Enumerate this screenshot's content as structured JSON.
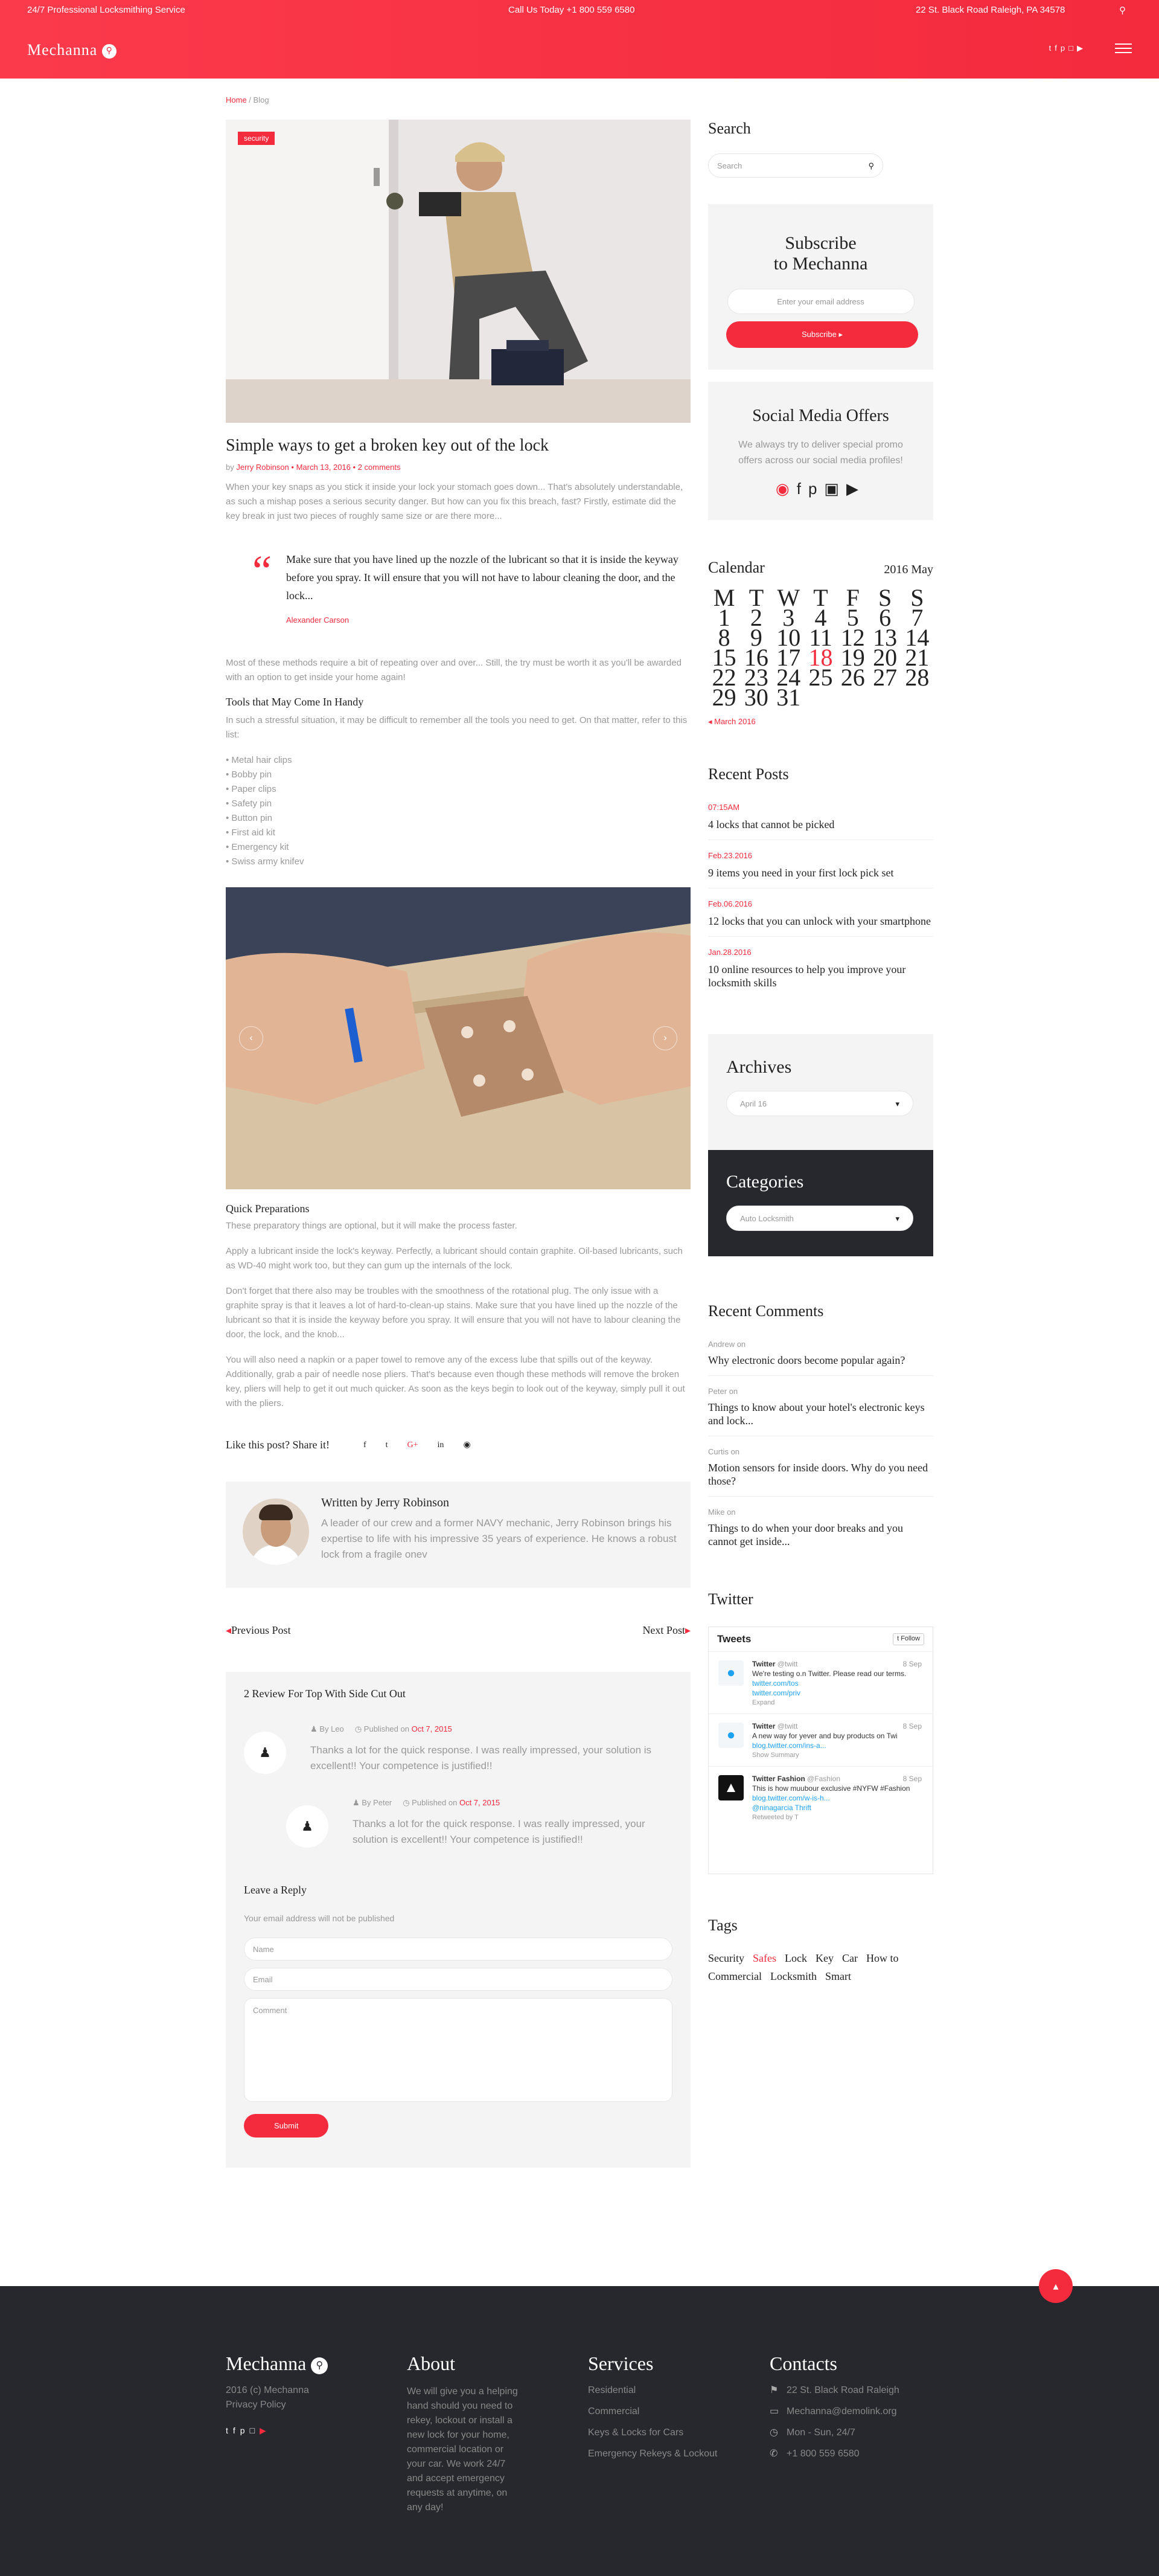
{
  "header": {
    "tagline": "24/7 Professional Locksmithing Service",
    "call": "Call Us Today +1 800 559 6580",
    "address": "22 St. Black Road Raleigh, PA 34578",
    "logo": "Mechanna",
    "social_icons": [
      "twitter-icon",
      "facebook-icon",
      "pinterest-icon",
      "instagram-icon",
      "youtube-icon"
    ]
  },
  "breadcrumb": {
    "home": "Home",
    "sep": " / ",
    "current": "Blog"
  },
  "post": {
    "category": "security",
    "title": "Simple ways to get a broken key out of the lock",
    "by": "by ",
    "author": "Jerry Robinson",
    "date": "March 13, 2016",
    "comments": "2 comments",
    "intro": "When your key snaps as you stick it inside your lock your stomach goes down... That's absolutely understandable, as such a mishap poses a serious security danger. But how can you fix this breach, fast? Firstly, estimate did the key break in just two pieces of roughly same size or are there more...",
    "quote_text": "Make sure that you have lined up the nozzle of the lubricant so that it is inside the keyway before you spray. It will ensure that you will not have to labour cleaning the door, and the lock...",
    "quote_author": "Alexander Carson",
    "para2": "Most of these methods require a bit of repeating over and over... Still, the try must be worth it as you'll be awarded with an option to get inside your home again!",
    "tools_heading": "Tools that May Come In Handy",
    "tools_intro": "In such a stressful situation, it may be difficult to remember all the tools you need to get. On that matter, refer to this list:",
    "tools": [
      "• Metal hair clips",
      "• Bobby pin",
      "• Paper clips",
      "• Safety pin",
      "• Button pin",
      "• First aid kit",
      "• Emergency kit",
      "• Swiss army knifev"
    ],
    "prep_heading": "Quick Preparations",
    "prep1": "These preparatory things are optional, but it will make the process faster.",
    "prep2": "Apply a lubricant inside the lock's keyway. Perfectly, a lubricant should contain graphite. Oil-based lubricants, such as WD-40 might work too, but they can gum up the internals of the lock.",
    "prep3": "Don't forget that there also may be troubles with the smoothness of the rotational plug. The only issue with a graphite spray is that it leaves a lot of hard-to-clean-up stains. Make sure that you have lined up the nozzle of the lubricant so that it is inside the keyway before you spray. It will ensure that you will not have to labour cleaning the door, the lock, and the knob...",
    "prep4": "You will also need a napkin or a paper towel to remove any of the excess lube that spills out of the keyway. Additionally, grab a pair of needle nose pliers. That's because even though these methods will remove the broken key, pliers will help to get it out much quicker. As soon as the keys begin to look out of the keyway, simply pull it out with the pliers.",
    "share_label": "Like this post? Share it!",
    "share_icons": [
      "facebook-icon",
      "twitter-icon",
      "google-plus-icon",
      "linkedin-icon",
      "pinterest-icon"
    ]
  },
  "author_box": {
    "written": "Written by Jerry Robinson",
    "bio": "A leader of our crew and a former NAVY mechanic, Jerry Robinson brings his expertise to life with his impressive 35 years of experience. He knows a robust lock from a fragile onev"
  },
  "post_nav": {
    "prev": "Previous Post",
    "next": "Next Post"
  },
  "comments": {
    "title": "2 Review For Top With Side Cut Out",
    "items": [
      {
        "by": "By Leo",
        "published": "Published on ",
        "date": "Oct 7, 2015",
        "text": "Thanks a lot for the quick response. I was really impressed, your solution is excellent!! Your competence is justified!!"
      },
      {
        "by": "By Peter",
        "published": "Published on ",
        "date": "Oct 7, 2015",
        "text": "Thanks a lot for the quick response. I was really impressed, your solution is excellent!! Your competence is justified!!"
      }
    ],
    "reply_title": "Leave a Reply",
    "note": "Your email address will not be published",
    "name_ph": "Name",
    "email_ph": "Email",
    "comment_ph": "Comment",
    "submit": "Submit"
  },
  "sidebar": {
    "search_title": "Search",
    "search_ph": "Search",
    "subscribe_title1": "Subscribe",
    "subscribe_title2": "to Mechanna",
    "email_ph": "Enter your email address",
    "subscribe_btn": "Subscribe",
    "social_title": "Social Media Offers",
    "social_text": "We always try to deliver special promo offers across our social media profiles!",
    "calendar_title": "Calendar",
    "calendar_month": "2016 May",
    "calendar_days": [
      "M",
      "T",
      "W",
      "T",
      "F",
      "S",
      "S",
      "1",
      "2",
      "3",
      "4",
      "5",
      "6",
      "7",
      "8",
      "9",
      "10",
      "11",
      "12",
      "13",
      "14",
      "15",
      "16",
      "17",
      "18",
      "19",
      "20",
      "21",
      "22",
      "23",
      "24",
      "25",
      "26",
      "27",
      "28",
      "29",
      "30",
      "31",
      "",
      "",
      "",
      ""
    ],
    "calendar_highlight": "18",
    "calendar_prev": "March 2016",
    "recent_title": "Recent Posts",
    "recent": [
      {
        "date": "07:15AM",
        "title": "4 locks that cannot be picked"
      },
      {
        "date": "Feb.23.2016",
        "title": "9 items you need in your first lock pick set"
      },
      {
        "date": "Feb.06.2016",
        "title": "12 locks that you can unlock with your smartphone"
      },
      {
        "date": "Jan.28.2016",
        "title": "10 online resources to help you improve your locksmith skills"
      }
    ],
    "archives_title": "Archives",
    "archives_value": "April 16",
    "categories_title": "Categories",
    "categories_value": "Auto Locksmith",
    "rc_title": "Recent Comments",
    "rc": [
      {
        "author": "Andrew",
        "on": " on",
        "title": "Why electronic doors become popular again?"
      },
      {
        "author": "Peter",
        "on": " on",
        "title": "Things to know about your hotel's electronic keys and lock..."
      },
      {
        "author": "Curtis",
        "on": " on",
        "title": "Motion sensors for inside doors. Why do you need those?"
      },
      {
        "author": "Mike",
        "on": " on",
        "title": "Things to do when your door breaks and you cannot get inside..."
      }
    ],
    "twitter_title": "Twitter",
    "tw_head": "Tweets",
    "tw_follow": "Follow",
    "tweets": [
      {
        "name": "Twitter",
        "handle": "@twitt",
        "date": "8 Sep",
        "text": "We're testing o.n Twitter. Please read our terms.",
        "link": "twitter.com/tos",
        "link2": "twitter.com/priv",
        "extra": "Expand"
      },
      {
        "name": "Twitter",
        "handle": "@twitt",
        "date": "8 Sep",
        "text": "A new way for yever and buy products on Twi",
        "link": "blog.twitter.com/ins-a...",
        "link2": "",
        "extra": "Show Summary"
      },
      {
        "name": "Twitter Fashion",
        "handle": "@Fashion",
        "date": "8 Sep",
        "text": "This is how muubour exclusive #NYFW #Fashion",
        "link": "blog.twitter.com/w-is-h...",
        "link2": "@ninagarcia Thrift",
        "extra": "Retweeted by T"
      }
    ],
    "tags_title": "Tags",
    "tags": [
      "Security",
      "Safes",
      "Lock",
      "Key",
      "Car",
      "How to",
      "Commercial",
      "Locksmith",
      "Smart"
    ]
  },
  "footer": {
    "logo": "Mechanna",
    "copy": "2016 (c) Mechanna",
    "privacy": "Privacy Policy",
    "about_title": "About",
    "about_text": "We will give you a helping hand should you need to rekey, lockout or install a new lock for your home, commercial location or your car. We work 24/7 and accept emergency requests at anytime, on any day!",
    "services_title": "Services",
    "services": [
      "Residential",
      "Commercial",
      "Keys & Locks for Cars",
      "Emergency Rekeys & Lockout"
    ],
    "contacts_title": "Contacts",
    "contacts": [
      "22 St. Black Road Raleigh",
      "Mechanna@demolink.org",
      "Mon - Sun, 24/7",
      "+1 800 559 6580"
    ]
  },
  "colors": {
    "accent": "#f42a3d",
    "dark": "#27272e",
    "muted": "#999999"
  }
}
